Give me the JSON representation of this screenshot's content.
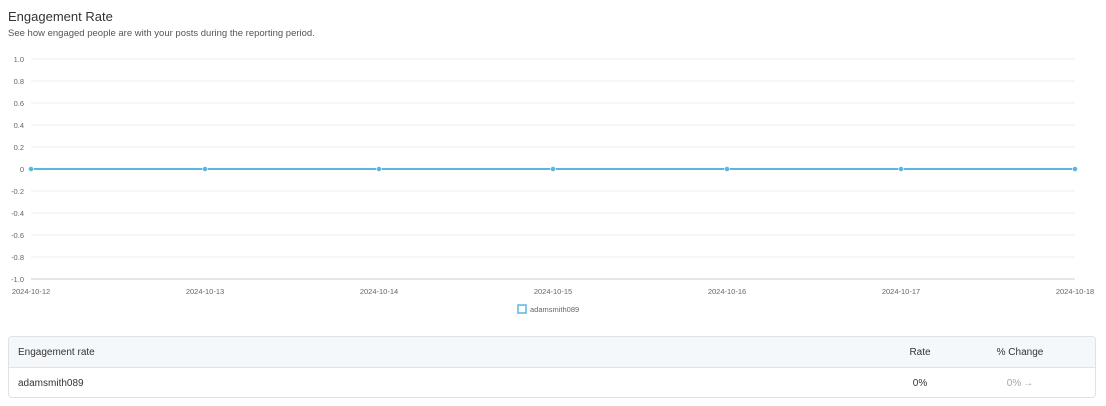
{
  "header": {
    "title": "Engagement Rate",
    "subtitle": "See how engaged people are with your posts during the reporting period."
  },
  "chart_data": {
    "type": "line",
    "x": [
      "2024-10-12",
      "2024-10-13",
      "2024-10-14",
      "2024-10-15",
      "2024-10-16",
      "2024-10-17",
      "2024-10-18"
    ],
    "series": [
      {
        "name": "adamsmith089",
        "values": [
          0,
          0,
          0,
          0,
          0,
          0,
          0
        ],
        "color": "#5bb6e0"
      }
    ],
    "yticks": [
      "1.0",
      "0.8",
      "0.6",
      "0.4",
      "0.2",
      "0",
      "-0.2",
      "-0.4",
      "-0.6",
      "-0.8",
      "-1.0"
    ],
    "ylim": [
      -1.0,
      1.0
    ],
    "grid": true,
    "legend_position": "bottom-center"
  },
  "table": {
    "headers": {
      "name": "Engagement rate",
      "rate": "Rate",
      "change": "% Change"
    },
    "rows": [
      {
        "name": "adamsmith089",
        "rate": "0%",
        "change": "0%"
      }
    ]
  },
  "colors": {
    "series": "#5bb6e0",
    "grid": "#eeeeee",
    "table_header_bg": "#f5f8fa",
    "table_border": "#dfe3e8"
  }
}
